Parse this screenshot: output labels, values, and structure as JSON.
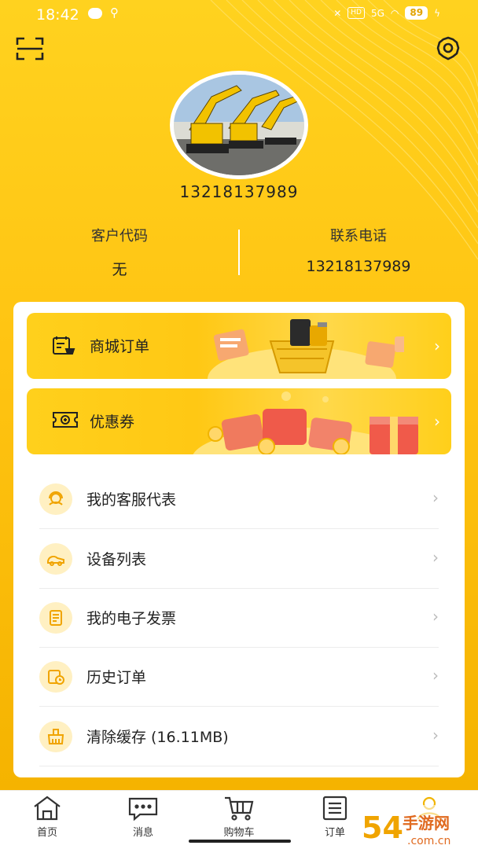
{
  "status_bar": {
    "time": "18:42",
    "hd_badge": "HD",
    "network": "5G",
    "battery": "89"
  },
  "header": {
    "scan_icon": "scan-icon",
    "settings_icon": "gear-icon"
  },
  "profile": {
    "phone": "13218137989",
    "customer_code_label": "客户代码",
    "customer_code_value": "无",
    "contact_phone_label": "联系电话",
    "contact_phone_value": "13218137989"
  },
  "banners": [
    {
      "label": "商城订单",
      "icon": "shop-cart-icon"
    },
    {
      "label": "优惠券",
      "icon": "coupon-icon"
    }
  ],
  "menu": [
    {
      "label": "我的客服代表",
      "icon": "customer-service-icon"
    },
    {
      "label": "设备列表",
      "icon": "device-icon"
    },
    {
      "label": "我的电子发票",
      "icon": "invoice-icon"
    },
    {
      "label": "历史订单",
      "icon": "history-order-icon"
    },
    {
      "label": "清除缓存 (16.11MB)",
      "icon": "clear-cache-icon"
    }
  ],
  "tabbar": [
    {
      "label": "首页",
      "icon": "home-icon"
    },
    {
      "label": "消息",
      "icon": "message-icon"
    },
    {
      "label": "购物车",
      "icon": "cart-icon"
    },
    {
      "label": "订单",
      "icon": "order-icon"
    },
    {
      "label": "",
      "icon": "profile-icon"
    }
  ],
  "watermark": {
    "text": "5"
  },
  "colors": {
    "brand_yellow": "#ffc412",
    "light_yellow": "#fff0c2",
    "accent_red": "#f05a4a"
  }
}
